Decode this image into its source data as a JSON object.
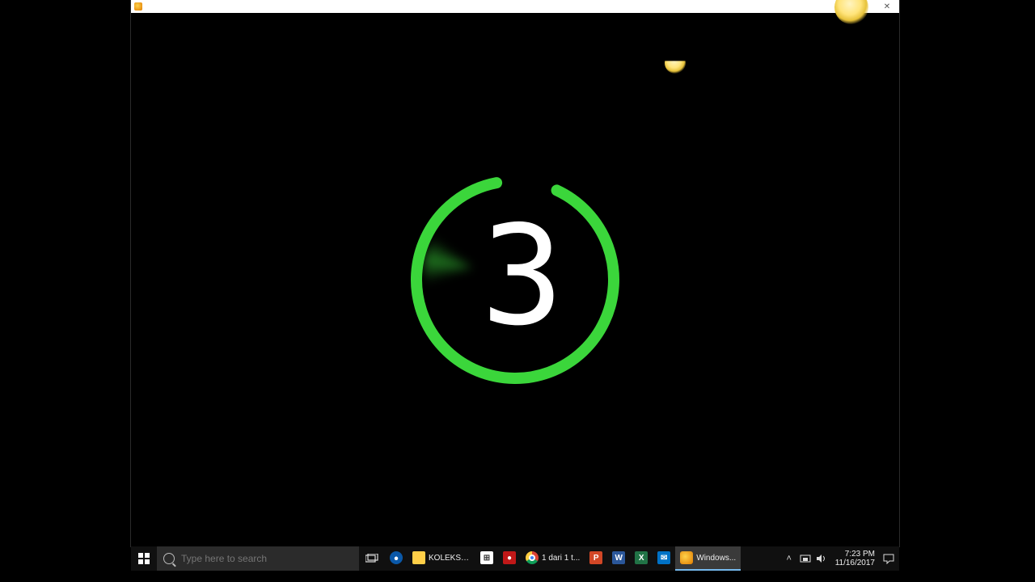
{
  "window": {
    "minimize_glyph": "—",
    "maximize_glyph": "☐",
    "close_glyph": "✕"
  },
  "countdown": {
    "digit": "3",
    "ring_color": "#3bd63b"
  },
  "search": {
    "placeholder": "Type here to search"
  },
  "taskbar": {
    "items": [
      {
        "label": "",
        "icon": "edge"
      },
      {
        "label": "KOLEKSI ...",
        "icon": "folder"
      },
      {
        "label": "",
        "icon": "store"
      },
      {
        "label": "",
        "icon": "red"
      },
      {
        "label": "1 dari 1 t...",
        "icon": "chrome"
      },
      {
        "label": "",
        "icon": "pp"
      },
      {
        "label": "",
        "icon": "wd"
      },
      {
        "label": "",
        "icon": "xl"
      },
      {
        "label": "",
        "icon": "mail"
      },
      {
        "label": "Windows...",
        "icon": "wmp",
        "active": true
      }
    ]
  },
  "tray": {
    "time": "7:23 PM",
    "date": "11/16/2017"
  },
  "icon_letters": {
    "pp": "P",
    "wd": "W",
    "xl": "X",
    "store": "⊞",
    "mail": "✉",
    "red": "●"
  }
}
